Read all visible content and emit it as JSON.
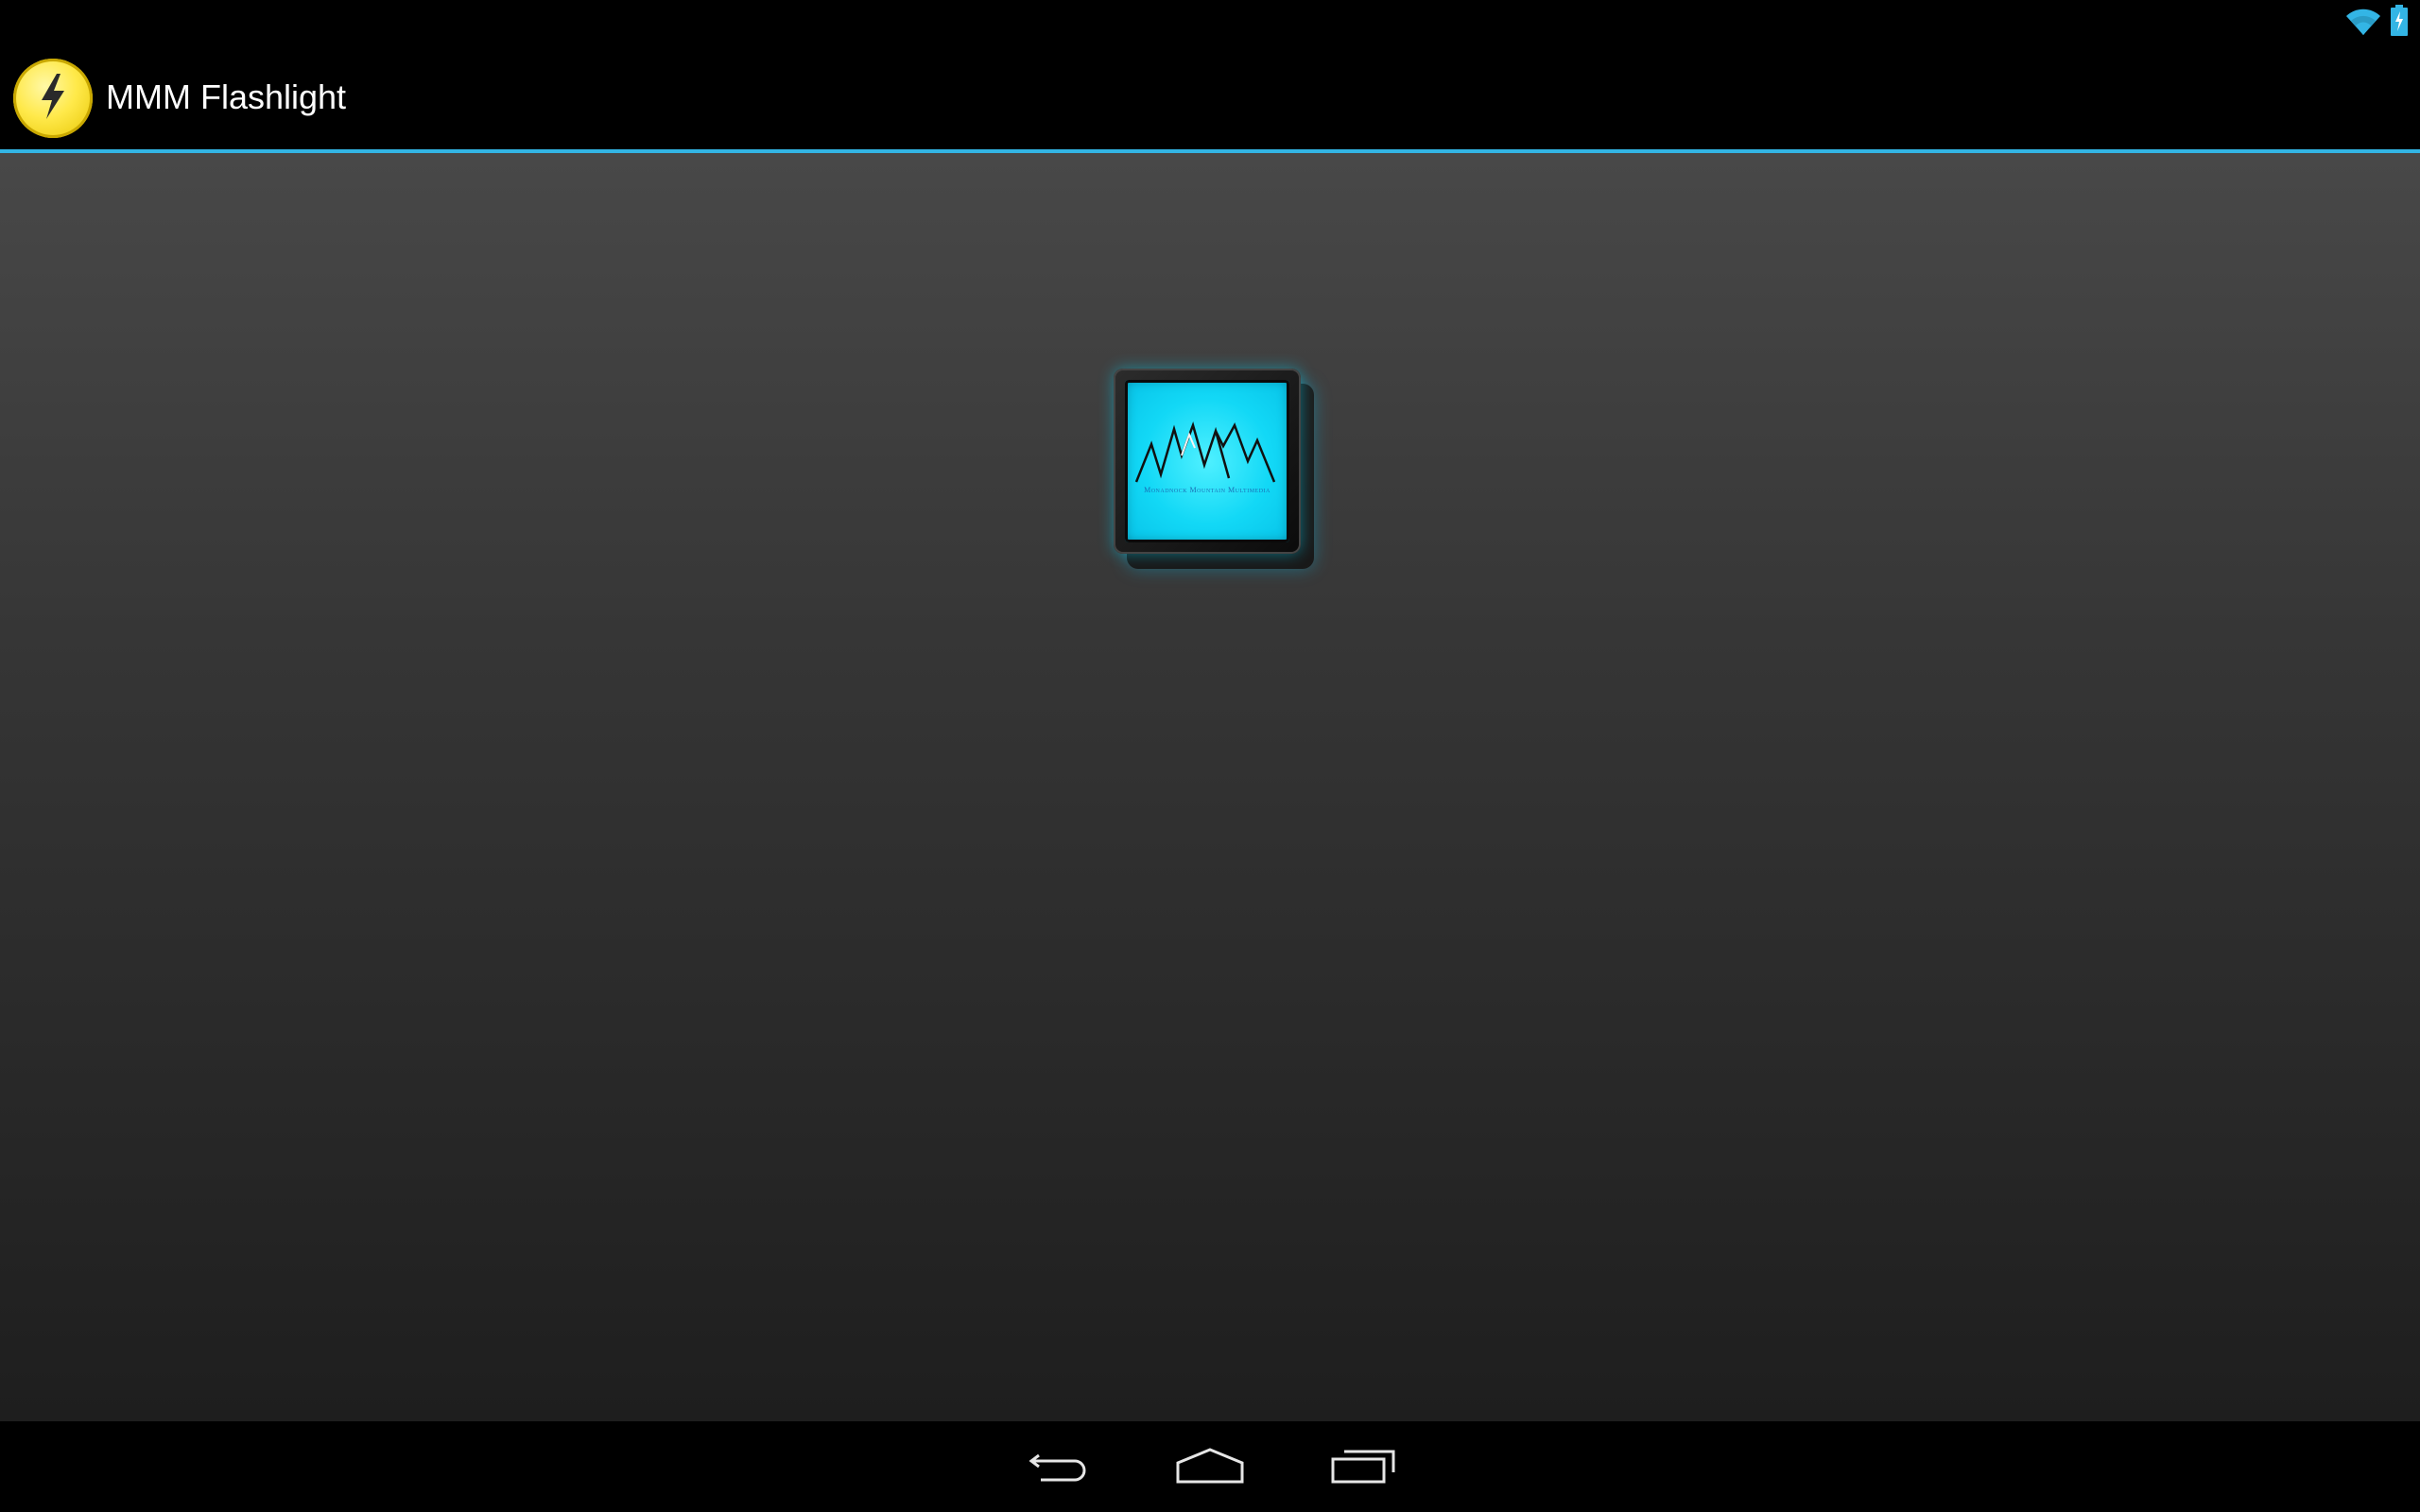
{
  "status_bar": {
    "wifi_icon": "wifi-icon",
    "battery_icon": "battery-charging-icon",
    "accent_color": "#33b5e5"
  },
  "action_bar": {
    "app_icon": "lightning-bolt-icon",
    "title": "MMM Flashlight",
    "divider_color": "#33b5e5"
  },
  "main": {
    "flashlight_button": {
      "icon": "mountain-logo-icon",
      "logo_caption": "Monadnock Mountain Multimedia",
      "face_color": "#12d8f6"
    }
  },
  "nav_bar": {
    "back_icon": "back-icon",
    "home_icon": "home-icon",
    "recents_icon": "recent-apps-icon"
  }
}
